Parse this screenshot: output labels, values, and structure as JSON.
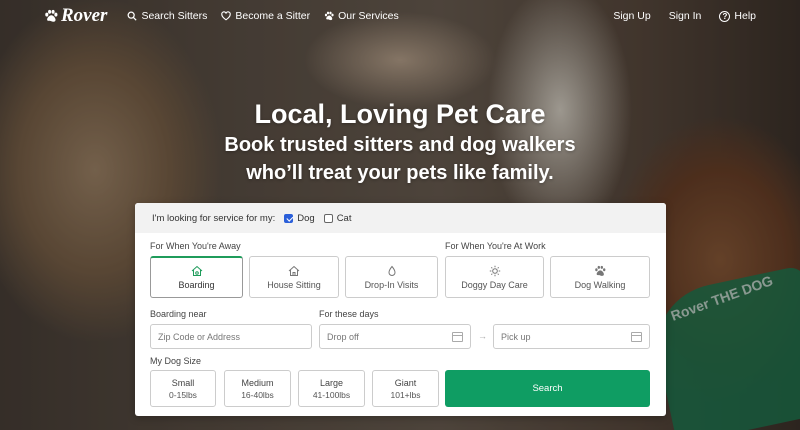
{
  "nav": {
    "brand": "Rover",
    "search_sitters": "Search Sitters",
    "become_sitter": "Become a Sitter",
    "our_services": "Our Services",
    "sign_up": "Sign Up",
    "sign_in": "Sign In",
    "help": "Help"
  },
  "hero": {
    "title": "Local, Loving Pet Care",
    "subtitle_line1": "Book trusted sitters and dog walkers",
    "subtitle_line2": "who’ll treat your pets like family.",
    "bandana_text": "Rover  THE DOG"
  },
  "search": {
    "service_for_label": "I'm looking for service for my:",
    "pets": [
      {
        "label": "Dog",
        "checked": true
      },
      {
        "label": "Cat",
        "checked": false
      }
    ],
    "away_label": "For When You're Away",
    "work_label": "For When You're At Work",
    "services": [
      {
        "label": "Boarding",
        "icon": "house-dog-icon",
        "selected": true
      },
      {
        "label": "House Sitting",
        "icon": "house-sitting-icon",
        "selected": false
      },
      {
        "label": "Drop-In Visits",
        "icon": "drop-in-icon",
        "selected": false
      },
      {
        "label": "Doggy Day Care",
        "icon": "sun-dog-icon",
        "selected": false
      },
      {
        "label": "Dog Walking",
        "icon": "paw-walk-icon",
        "selected": false
      }
    ],
    "boarding_near_label": "Boarding near",
    "zip_placeholder": "Zip Code or Address",
    "days_label": "For these days",
    "drop_off_placeholder": "Drop off",
    "pick_up_placeholder": "Pick up",
    "arrow": "→",
    "dog_size_label": "My Dog Size",
    "sizes": [
      {
        "label": "Small",
        "range": "0-15lbs"
      },
      {
        "label": "Medium",
        "range": "16-40lbs"
      },
      {
        "label": "Large",
        "range": "41-100lbs"
      },
      {
        "label": "Giant",
        "range": "101+lbs"
      }
    ],
    "search_button": "Search"
  },
  "colors": {
    "brand_green": "#0f9d63",
    "checkbox_blue": "#2b5fd9"
  }
}
